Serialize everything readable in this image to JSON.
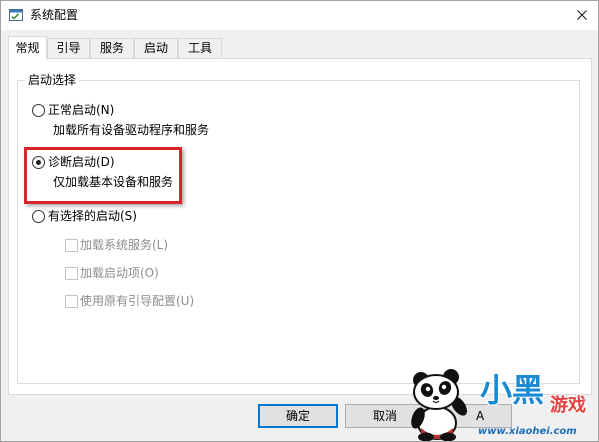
{
  "window": {
    "title": "系统配置",
    "icon": "msconfig-icon",
    "close_icon": "close-icon"
  },
  "tabs": [
    {
      "label": "常规",
      "selected": true
    },
    {
      "label": "引导",
      "selected": false
    },
    {
      "label": "服务",
      "selected": false
    },
    {
      "label": "启动",
      "selected": false
    },
    {
      "label": "工具",
      "selected": false
    }
  ],
  "startup_selection": {
    "group_label": "启动选择",
    "options": [
      {
        "label": "正常启动(N)",
        "description": "加载所有设备驱动程序和服务",
        "checked": false
      },
      {
        "label": "诊断启动(D)",
        "description": "仅加载基本设备和服务",
        "checked": true,
        "highlighted": true
      },
      {
        "label": "有选择的启动(S)",
        "checked": false
      }
    ],
    "selective_items": [
      {
        "label": "加载系统服务(L)",
        "checked": false,
        "disabled": true
      },
      {
        "label": "加载启动项(O)",
        "checked": false,
        "disabled": true
      },
      {
        "label": "使用原有引导配置(U)",
        "checked": false,
        "disabled": true
      }
    ]
  },
  "buttons": {
    "ok_label": "确定",
    "ok_is_default": true,
    "cancel_label": "取消",
    "apply_label_visible": "A"
  },
  "watermark": {
    "mascot_icon": "panda-icon",
    "logo_main": "小黑",
    "logo_sub": "游戏",
    "url": "www.xiaohei.com"
  },
  "colors": {
    "accent": "#0078d7",
    "highlight": "#d7262b",
    "disabled_text": "#8d8d8d",
    "watermark_blue": "#1a8ad4",
    "watermark_red": "#e5403f",
    "watermark_url": "#1d6fb8"
  }
}
